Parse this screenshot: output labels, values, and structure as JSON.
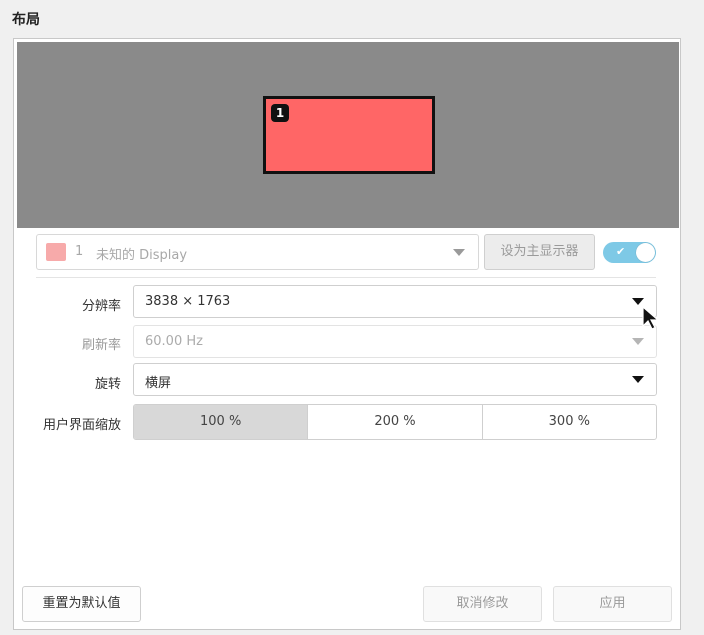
{
  "section": {
    "title": "布局"
  },
  "preview": {
    "monitor_number": "1",
    "monitor_color": "#ff6666"
  },
  "display_selector": {
    "number": "1",
    "name": "未知的 Display",
    "swatch_color": "#f7aaaa",
    "set_primary_label": "设为主显示器",
    "enabled_toggle": true
  },
  "settings": {
    "resolution": {
      "label": "分辨率",
      "value": "3838 × 1763"
    },
    "refresh_rate": {
      "label": "刷新率",
      "value": "60.00 Hz",
      "disabled": true
    },
    "rotation": {
      "label": "旋转",
      "value": "横屏"
    },
    "ui_scale": {
      "label": "用户界面缩放",
      "options": [
        "100 %",
        "200 %",
        "300 %"
      ],
      "selected": "100 %"
    }
  },
  "footer": {
    "reset_label": "重置为默认值",
    "revert_label": "取消修改",
    "apply_label": "应用"
  },
  "icons": {
    "toggle_check": "check-icon",
    "dropdown": "caret-down-icon",
    "cursor": "mouse-pointer-icon"
  }
}
